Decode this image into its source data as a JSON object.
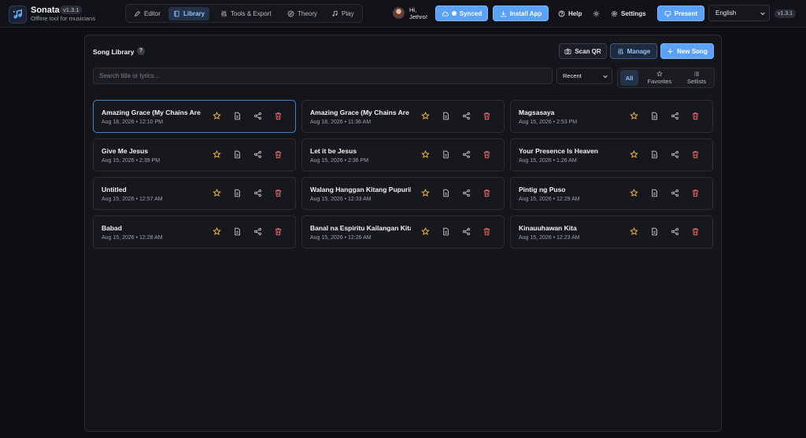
{
  "app": {
    "name": "Sonata",
    "version": "v1.3.1",
    "tagline": "Offline tool for musicians"
  },
  "nav": {
    "tabs": [
      {
        "label": "Editor",
        "icon": "edit-icon",
        "active": false
      },
      {
        "label": "Library",
        "icon": "book-icon",
        "active": true
      },
      {
        "label": "Tools & Export",
        "icon": "sliders-icon",
        "active": false
      },
      {
        "label": "Theory",
        "icon": "compass-icon",
        "active": false
      },
      {
        "label": "Play",
        "icon": "music-icon",
        "active": false
      }
    ]
  },
  "header": {
    "greeting": "Hi, Jethro!",
    "synced_label": "Synced",
    "install_label": "Install App",
    "help_label": "Help",
    "settings_label": "Settings",
    "present_label": "Present",
    "language": "English",
    "version_badge": "v1.3.1"
  },
  "library": {
    "title": "Song Library",
    "help_glyph": "?",
    "scan_label": "Scan QR",
    "manage_label": "Manage",
    "new_label": "New Song",
    "search_placeholder": "Search title or lyrics...",
    "sort_value": "Recent",
    "filters": [
      {
        "label": "All",
        "active": true
      },
      {
        "label": "Favorites",
        "active": false
      },
      {
        "label": "Setlists",
        "active": false
      }
    ]
  },
  "songs": [
    {
      "title": "Amazing Grace (My Chains Are Gone)",
      "date": "Aug 18, 2026 • 12:10 PM",
      "selected": true
    },
    {
      "title": "Amazing Grace (My Chains Are Gone)",
      "date": "Aug 18, 2026 • 11:36 AM",
      "selected": false
    },
    {
      "title": "Magsasaya",
      "date": "Aug 15, 2026 • 2:53 PM",
      "selected": false
    },
    {
      "title": "Give Me Jesus",
      "date": "Aug 15, 2026 • 2:39 PM",
      "selected": false
    },
    {
      "title": "Let it be Jesus",
      "date": "Aug 15, 2026 • 2:36 PM",
      "selected": false
    },
    {
      "title": "Your Presence Is Heaven",
      "date": "Aug 15, 2026 • 1:26 AM",
      "selected": false
    },
    {
      "title": "Untitled",
      "date": "Aug 15, 2026 • 12:57 AM",
      "selected": false
    },
    {
      "title": "Walang Hanggan Kitang Pupurihin",
      "date": "Aug 15, 2026 • 12:33 AM",
      "selected": false
    },
    {
      "title": "Pintig ng Puso",
      "date": "Aug 15, 2026 • 12:29 AM",
      "selected": false
    },
    {
      "title": "Babad",
      "date": "Aug 15, 2026 • 12:28 AM",
      "selected": false
    },
    {
      "title": "Banal na Espiritu Kailangan Kita",
      "date": "Aug 15, 2026 • 12:26 AM",
      "selected": false
    },
    {
      "title": "Kinauuhawan Kita",
      "date": "Aug 15, 2026 • 12:23 AM",
      "selected": false
    }
  ],
  "colors": {
    "accent": "#5aa2f7",
    "star": "#f5b942",
    "delete": "#ef6b6b",
    "background": "#0d0f13"
  }
}
